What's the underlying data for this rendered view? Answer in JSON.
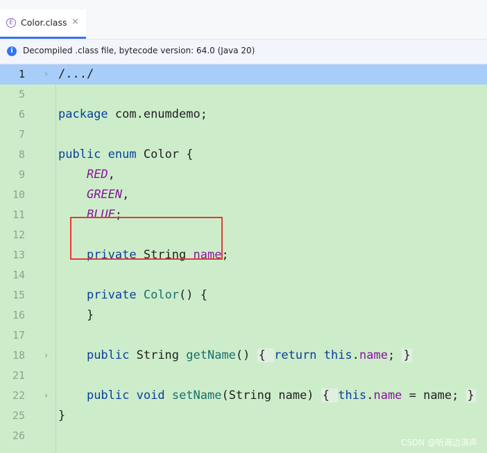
{
  "tab": {
    "icon_letter": "E",
    "label": "Color.class",
    "close": "×"
  },
  "banner": {
    "text": "Decompiled .class file, bytecode version: 64.0 (Java 20)"
  },
  "lines": [
    {
      "n": "1",
      "fold": "›",
      "current": true,
      "tokens": [
        [
          "t",
          "/.../"
        ]
      ]
    },
    {
      "n": "5",
      "tokens": []
    },
    {
      "n": "6",
      "tokens": [
        [
          "kw",
          "package"
        ],
        [
          "t",
          " com.enumdemo;"
        ]
      ]
    },
    {
      "n": "7",
      "tokens": []
    },
    {
      "n": "8",
      "tokens": [
        [
          "kw",
          "public"
        ],
        [
          "t",
          " "
        ],
        [
          "kw",
          "enum"
        ],
        [
          "t",
          " Color {"
        ]
      ]
    },
    {
      "n": "9",
      "tokens": [
        [
          "t",
          "    "
        ],
        [
          "enumc",
          "RED"
        ],
        [
          "t",
          ","
        ]
      ]
    },
    {
      "n": "10",
      "tokens": [
        [
          "t",
          "    "
        ],
        [
          "enumc",
          "GREEN"
        ],
        [
          "t",
          ","
        ]
      ]
    },
    {
      "n": "11",
      "tokens": [
        [
          "t",
          "    "
        ],
        [
          "enumc",
          "BLUE"
        ],
        [
          "t",
          ";"
        ]
      ]
    },
    {
      "n": "12",
      "tokens": []
    },
    {
      "n": "13",
      "tokens": [
        [
          "t",
          "    "
        ],
        [
          "kw",
          "private"
        ],
        [
          "t",
          " String "
        ],
        [
          "field",
          "name"
        ],
        [
          "t",
          ";"
        ]
      ]
    },
    {
      "n": "14",
      "tokens": []
    },
    {
      "n": "15",
      "tokens": [
        [
          "t",
          "    "
        ],
        [
          "kw",
          "private"
        ],
        [
          "t",
          " "
        ],
        [
          "fn",
          "Color"
        ],
        [
          "t",
          "() {"
        ]
      ]
    },
    {
      "n": "16",
      "tokens": [
        [
          "t",
          "    }"
        ]
      ]
    },
    {
      "n": "17",
      "tokens": []
    },
    {
      "n": "18",
      "fold": "›",
      "tokens": [
        [
          "t",
          "    "
        ],
        [
          "kw",
          "public"
        ],
        [
          "t",
          " String "
        ],
        [
          "fn",
          "getName"
        ],
        [
          "t",
          "() "
        ],
        [
          "box",
          "{ "
        ],
        [
          "kw",
          "return"
        ],
        [
          "t",
          " "
        ],
        [
          "kw",
          "this"
        ],
        [
          "t",
          "."
        ],
        [
          "field",
          "name"
        ],
        [
          "t",
          "; "
        ],
        [
          "box",
          "}"
        ]
      ]
    },
    {
      "n": "21",
      "tokens": []
    },
    {
      "n": "22",
      "fold": "›",
      "tokens": [
        [
          "t",
          "    "
        ],
        [
          "kw",
          "public"
        ],
        [
          "t",
          " "
        ],
        [
          "kw",
          "void"
        ],
        [
          "t",
          " "
        ],
        [
          "fn",
          "setName"
        ],
        [
          "t",
          "(String name) "
        ],
        [
          "box",
          "{ "
        ],
        [
          "kw",
          "this"
        ],
        [
          "t",
          "."
        ],
        [
          "field",
          "name"
        ],
        [
          "t",
          " = name; "
        ],
        [
          "box",
          "}"
        ]
      ]
    },
    {
      "n": "25",
      "tokens": [
        [
          "t",
          "}"
        ]
      ]
    },
    {
      "n": "26",
      "tokens": []
    }
  ],
  "watermark": "CSDN @听海边涛声"
}
